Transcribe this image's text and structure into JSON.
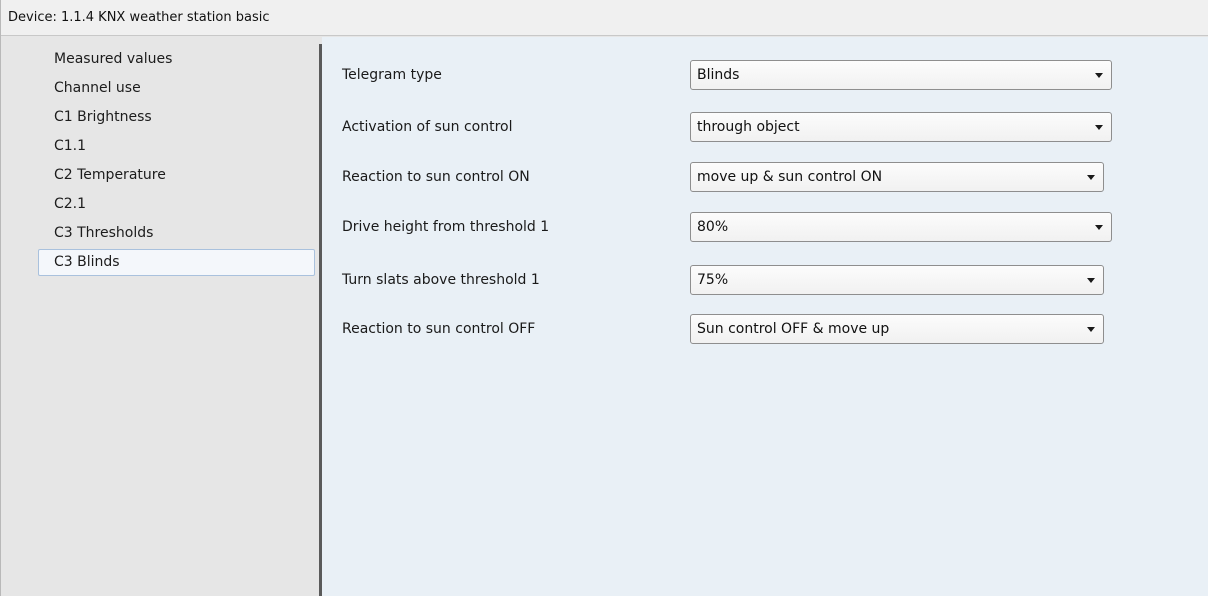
{
  "window": {
    "title": "Device: 1.1.4  KNX weather station basic"
  },
  "sidebar": {
    "items": [
      {
        "label": "Measured values"
      },
      {
        "label": "Channel use"
      },
      {
        "label": "C1 Brightness"
      },
      {
        "label": "C1.1"
      },
      {
        "label": "C2 Temperature"
      },
      {
        "label": "C2.1"
      },
      {
        "label": "C3 Thresholds"
      },
      {
        "label": "C3 Blinds",
        "selected": true
      }
    ]
  },
  "parameters": [
    {
      "label": "Telegram type",
      "value": "Blinds"
    },
    {
      "label": "Activation of sun control",
      "value": "through object"
    },
    {
      "label": "Reaction to sun control ON",
      "value": "move up & sun control ON"
    },
    {
      "label": "Drive height from threshold 1",
      "value": "80%"
    },
    {
      "label": "Turn slats above threshold 1",
      "value": "75%"
    },
    {
      "label": "Reaction to sun control OFF",
      "value": "Sun control OFF & move up"
    }
  ],
  "icons": {
    "dropdown_arrow": "chevron-down-icon"
  },
  "colors": {
    "content_background": "#e9f0f6",
    "sidebar_background": "#e6e6e6",
    "selection_border": "#a9c1dd",
    "splitter": "#5a5a5a"
  }
}
